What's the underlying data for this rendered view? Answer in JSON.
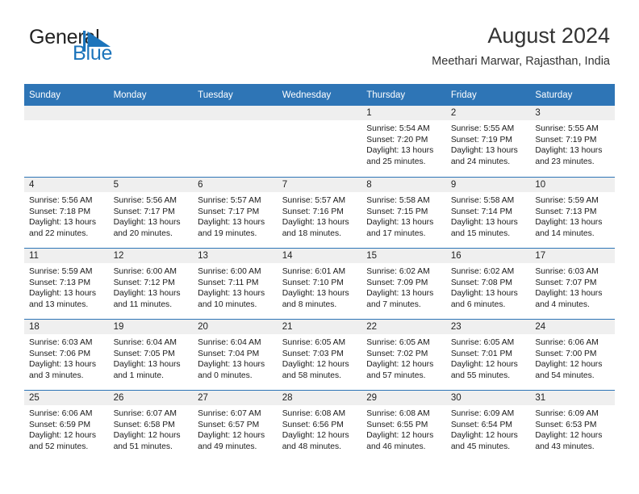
{
  "brand": {
    "name_part1": "General",
    "name_part2": "Blue",
    "logo_icon": "blue-flag-triangle-icon"
  },
  "header": {
    "title": "August 2024",
    "subtitle": "Meethari Marwar, Rajasthan, India"
  },
  "colors": {
    "header_blue": "#2e75b6",
    "daynum_gray": "#efefef",
    "brand_blue": "#1c74bb",
    "text": "#1a1a1a"
  },
  "weekday_headers": [
    "Sunday",
    "Monday",
    "Tuesday",
    "Wednesday",
    "Thursday",
    "Friday",
    "Saturday"
  ],
  "weeks": [
    [
      {
        "day": "",
        "sunrise": "",
        "sunset": "",
        "daylight_line1": "",
        "daylight_line2": ""
      },
      {
        "day": "",
        "sunrise": "",
        "sunset": "",
        "daylight_line1": "",
        "daylight_line2": ""
      },
      {
        "day": "",
        "sunrise": "",
        "sunset": "",
        "daylight_line1": "",
        "daylight_line2": ""
      },
      {
        "day": "",
        "sunrise": "",
        "sunset": "",
        "daylight_line1": "",
        "daylight_line2": ""
      },
      {
        "day": "1",
        "sunrise": "Sunrise: 5:54 AM",
        "sunset": "Sunset: 7:20 PM",
        "daylight_line1": "Daylight: 13 hours",
        "daylight_line2": "and 25 minutes."
      },
      {
        "day": "2",
        "sunrise": "Sunrise: 5:55 AM",
        "sunset": "Sunset: 7:19 PM",
        "daylight_line1": "Daylight: 13 hours",
        "daylight_line2": "and 24 minutes."
      },
      {
        "day": "3",
        "sunrise": "Sunrise: 5:55 AM",
        "sunset": "Sunset: 7:19 PM",
        "daylight_line1": "Daylight: 13 hours",
        "daylight_line2": "and 23 minutes."
      }
    ],
    [
      {
        "day": "4",
        "sunrise": "Sunrise: 5:56 AM",
        "sunset": "Sunset: 7:18 PM",
        "daylight_line1": "Daylight: 13 hours",
        "daylight_line2": "and 22 minutes."
      },
      {
        "day": "5",
        "sunrise": "Sunrise: 5:56 AM",
        "sunset": "Sunset: 7:17 PM",
        "daylight_line1": "Daylight: 13 hours",
        "daylight_line2": "and 20 minutes."
      },
      {
        "day": "6",
        "sunrise": "Sunrise: 5:57 AM",
        "sunset": "Sunset: 7:17 PM",
        "daylight_line1": "Daylight: 13 hours",
        "daylight_line2": "and 19 minutes."
      },
      {
        "day": "7",
        "sunrise": "Sunrise: 5:57 AM",
        "sunset": "Sunset: 7:16 PM",
        "daylight_line1": "Daylight: 13 hours",
        "daylight_line2": "and 18 minutes."
      },
      {
        "day": "8",
        "sunrise": "Sunrise: 5:58 AM",
        "sunset": "Sunset: 7:15 PM",
        "daylight_line1": "Daylight: 13 hours",
        "daylight_line2": "and 17 minutes."
      },
      {
        "day": "9",
        "sunrise": "Sunrise: 5:58 AM",
        "sunset": "Sunset: 7:14 PM",
        "daylight_line1": "Daylight: 13 hours",
        "daylight_line2": "and 15 minutes."
      },
      {
        "day": "10",
        "sunrise": "Sunrise: 5:59 AM",
        "sunset": "Sunset: 7:13 PM",
        "daylight_line1": "Daylight: 13 hours",
        "daylight_line2": "and 14 minutes."
      }
    ],
    [
      {
        "day": "11",
        "sunrise": "Sunrise: 5:59 AM",
        "sunset": "Sunset: 7:13 PM",
        "daylight_line1": "Daylight: 13 hours",
        "daylight_line2": "and 13 minutes."
      },
      {
        "day": "12",
        "sunrise": "Sunrise: 6:00 AM",
        "sunset": "Sunset: 7:12 PM",
        "daylight_line1": "Daylight: 13 hours",
        "daylight_line2": "and 11 minutes."
      },
      {
        "day": "13",
        "sunrise": "Sunrise: 6:00 AM",
        "sunset": "Sunset: 7:11 PM",
        "daylight_line1": "Daylight: 13 hours",
        "daylight_line2": "and 10 minutes."
      },
      {
        "day": "14",
        "sunrise": "Sunrise: 6:01 AM",
        "sunset": "Sunset: 7:10 PM",
        "daylight_line1": "Daylight: 13 hours",
        "daylight_line2": "and 8 minutes."
      },
      {
        "day": "15",
        "sunrise": "Sunrise: 6:02 AM",
        "sunset": "Sunset: 7:09 PM",
        "daylight_line1": "Daylight: 13 hours",
        "daylight_line2": "and 7 minutes."
      },
      {
        "day": "16",
        "sunrise": "Sunrise: 6:02 AM",
        "sunset": "Sunset: 7:08 PM",
        "daylight_line1": "Daylight: 13 hours",
        "daylight_line2": "and 6 minutes."
      },
      {
        "day": "17",
        "sunrise": "Sunrise: 6:03 AM",
        "sunset": "Sunset: 7:07 PM",
        "daylight_line1": "Daylight: 13 hours",
        "daylight_line2": "and 4 minutes."
      }
    ],
    [
      {
        "day": "18",
        "sunrise": "Sunrise: 6:03 AM",
        "sunset": "Sunset: 7:06 PM",
        "daylight_line1": "Daylight: 13 hours",
        "daylight_line2": "and 3 minutes."
      },
      {
        "day": "19",
        "sunrise": "Sunrise: 6:04 AM",
        "sunset": "Sunset: 7:05 PM",
        "daylight_line1": "Daylight: 13 hours",
        "daylight_line2": "and 1 minute."
      },
      {
        "day": "20",
        "sunrise": "Sunrise: 6:04 AM",
        "sunset": "Sunset: 7:04 PM",
        "daylight_line1": "Daylight: 13 hours",
        "daylight_line2": "and 0 minutes."
      },
      {
        "day": "21",
        "sunrise": "Sunrise: 6:05 AM",
        "sunset": "Sunset: 7:03 PM",
        "daylight_line1": "Daylight: 12 hours",
        "daylight_line2": "and 58 minutes."
      },
      {
        "day": "22",
        "sunrise": "Sunrise: 6:05 AM",
        "sunset": "Sunset: 7:02 PM",
        "daylight_line1": "Daylight: 12 hours",
        "daylight_line2": "and 57 minutes."
      },
      {
        "day": "23",
        "sunrise": "Sunrise: 6:05 AM",
        "sunset": "Sunset: 7:01 PM",
        "daylight_line1": "Daylight: 12 hours",
        "daylight_line2": "and 55 minutes."
      },
      {
        "day": "24",
        "sunrise": "Sunrise: 6:06 AM",
        "sunset": "Sunset: 7:00 PM",
        "daylight_line1": "Daylight: 12 hours",
        "daylight_line2": "and 54 minutes."
      }
    ],
    [
      {
        "day": "25",
        "sunrise": "Sunrise: 6:06 AM",
        "sunset": "Sunset: 6:59 PM",
        "daylight_line1": "Daylight: 12 hours",
        "daylight_line2": "and 52 minutes."
      },
      {
        "day": "26",
        "sunrise": "Sunrise: 6:07 AM",
        "sunset": "Sunset: 6:58 PM",
        "daylight_line1": "Daylight: 12 hours",
        "daylight_line2": "and 51 minutes."
      },
      {
        "day": "27",
        "sunrise": "Sunrise: 6:07 AM",
        "sunset": "Sunset: 6:57 PM",
        "daylight_line1": "Daylight: 12 hours",
        "daylight_line2": "and 49 minutes."
      },
      {
        "day": "28",
        "sunrise": "Sunrise: 6:08 AM",
        "sunset": "Sunset: 6:56 PM",
        "daylight_line1": "Daylight: 12 hours",
        "daylight_line2": "and 48 minutes."
      },
      {
        "day": "29",
        "sunrise": "Sunrise: 6:08 AM",
        "sunset": "Sunset: 6:55 PM",
        "daylight_line1": "Daylight: 12 hours",
        "daylight_line2": "and 46 minutes."
      },
      {
        "day": "30",
        "sunrise": "Sunrise: 6:09 AM",
        "sunset": "Sunset: 6:54 PM",
        "daylight_line1": "Daylight: 12 hours",
        "daylight_line2": "and 45 minutes."
      },
      {
        "day": "31",
        "sunrise": "Sunrise: 6:09 AM",
        "sunset": "Sunset: 6:53 PM",
        "daylight_line1": "Daylight: 12 hours",
        "daylight_line2": "and 43 minutes."
      }
    ]
  ]
}
